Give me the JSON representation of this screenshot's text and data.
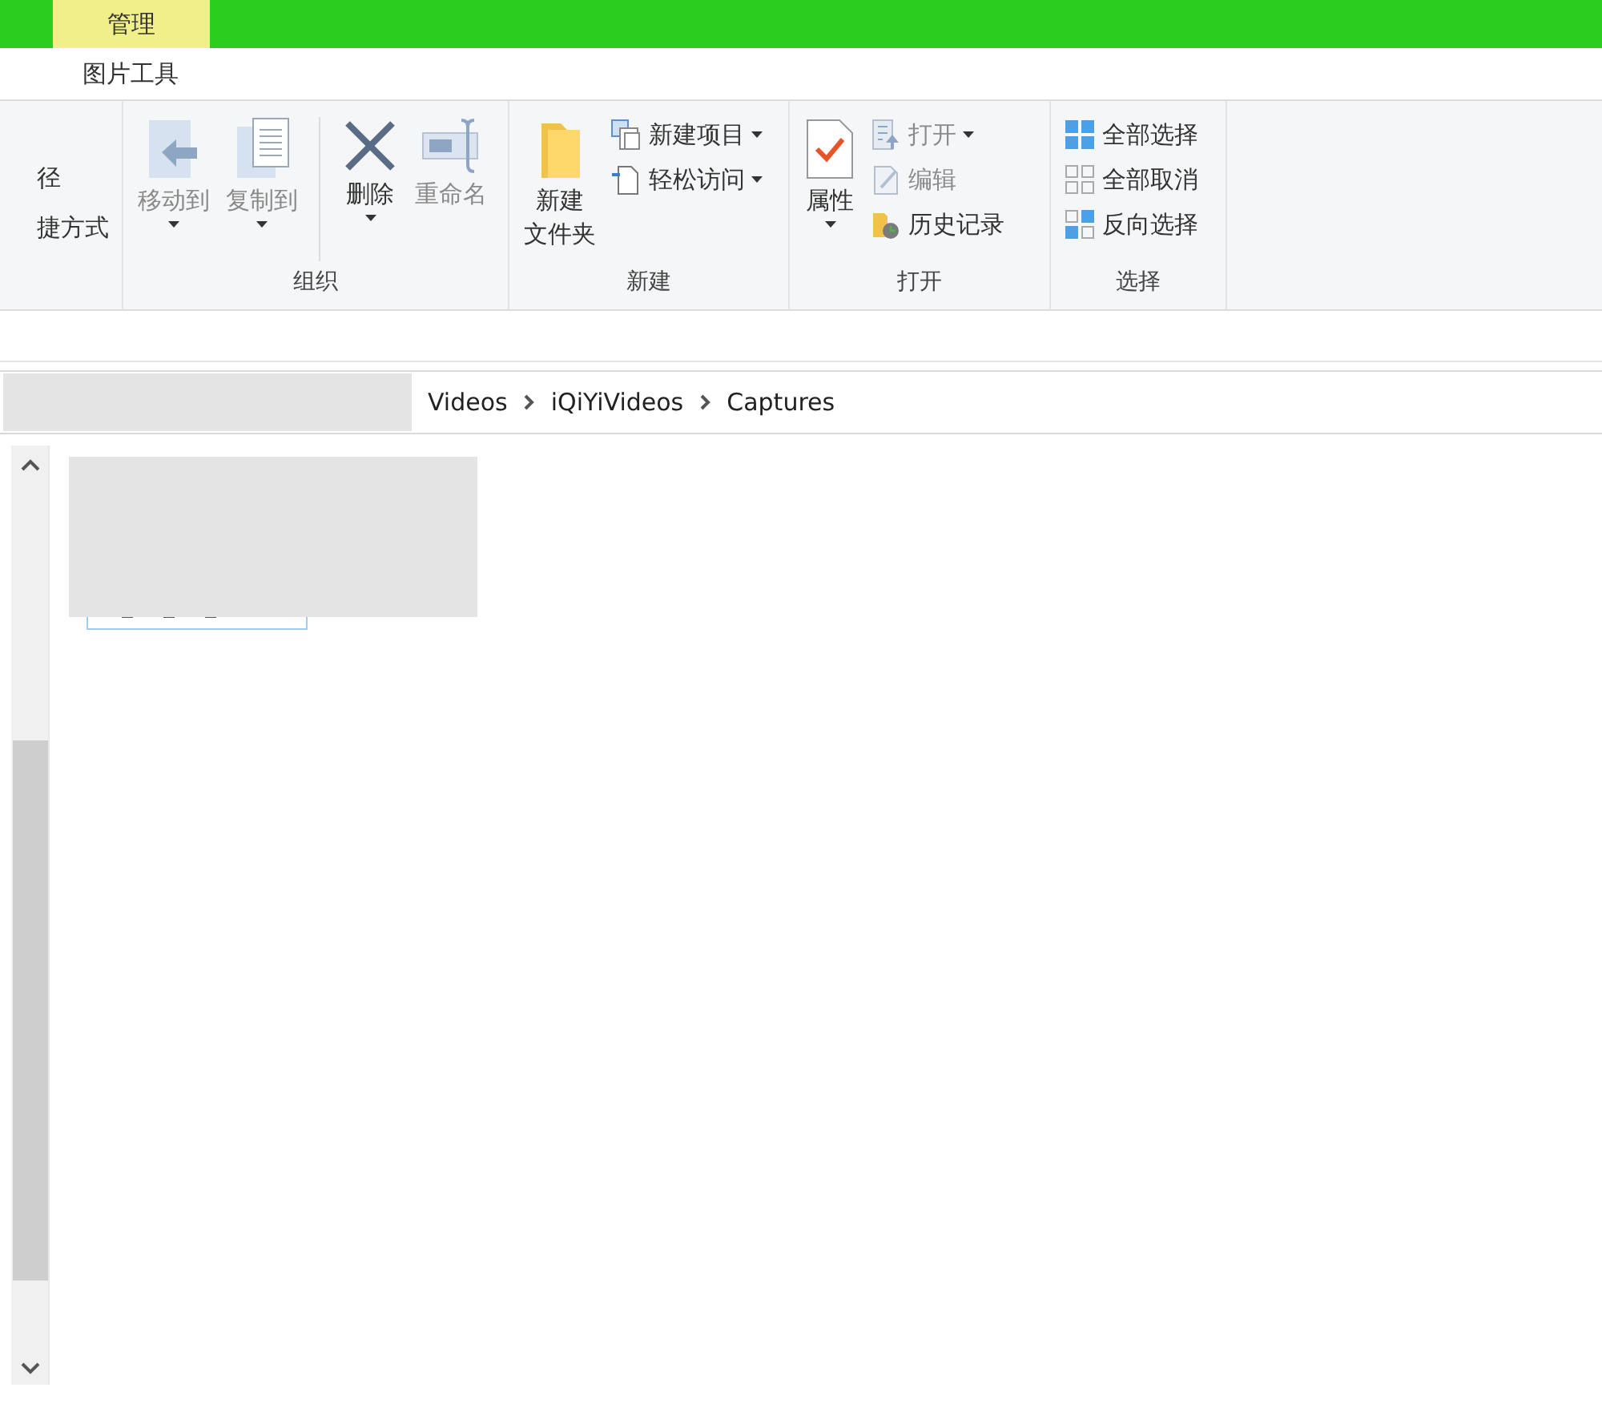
{
  "context_tab": {
    "group_label": "管理",
    "tab_label": "图片工具"
  },
  "ribbon": {
    "groups": [
      {
        "items": [
          {
            "kind": "small",
            "label": "径",
            "disabled": false,
            "dropdown": false
          },
          {
            "kind": "small",
            "label": "捷方式",
            "disabled": false,
            "dropdown": false
          }
        ]
      },
      {
        "label": "组织",
        "items": [
          {
            "kind": "large",
            "label": "移动到",
            "disabled": true,
            "dropdown": true
          },
          {
            "kind": "large",
            "label": "复制到",
            "disabled": true,
            "dropdown": true
          },
          {
            "kind": "separator"
          },
          {
            "kind": "large",
            "label": "删除",
            "disabled": false,
            "dropdown": true
          },
          {
            "kind": "large",
            "label": "重命名",
            "disabled": true,
            "dropdown": false
          }
        ]
      },
      {
        "label": "新建",
        "items": [
          {
            "kind": "large",
            "label_lines": [
              "新建",
              "文件夹"
            ],
            "disabled": false,
            "dropdown": false
          },
          {
            "kind": "small",
            "label": "新建项目",
            "disabled": false,
            "dropdown": true
          },
          {
            "kind": "small",
            "label": "轻松访问",
            "disabled": false,
            "dropdown": true
          }
        ]
      },
      {
        "label": "打开",
        "items": [
          {
            "kind": "large",
            "label": "属性",
            "disabled": false,
            "dropdown": true
          },
          {
            "kind": "small",
            "label": "打开",
            "disabled": true,
            "dropdown": true
          },
          {
            "kind": "small",
            "label": "编辑",
            "disabled": true,
            "dropdown": false
          },
          {
            "kind": "small",
            "label": "历史记录",
            "disabled": false,
            "dropdown": false
          }
        ]
      },
      {
        "label": "选择",
        "items": [
          {
            "kind": "small",
            "label": "全部选择",
            "disabled": false,
            "dropdown": false
          },
          {
            "kind": "small",
            "label": "全部取消",
            "disabled": false,
            "dropdown": false
          },
          {
            "kind": "small",
            "label": "反向选择",
            "disabled": false,
            "dropdown": false
          }
        ]
      }
    ]
  },
  "address_bar": {
    "segments": [
      "Videos",
      "iQiYiVideos",
      "Captures"
    ]
  }
}
